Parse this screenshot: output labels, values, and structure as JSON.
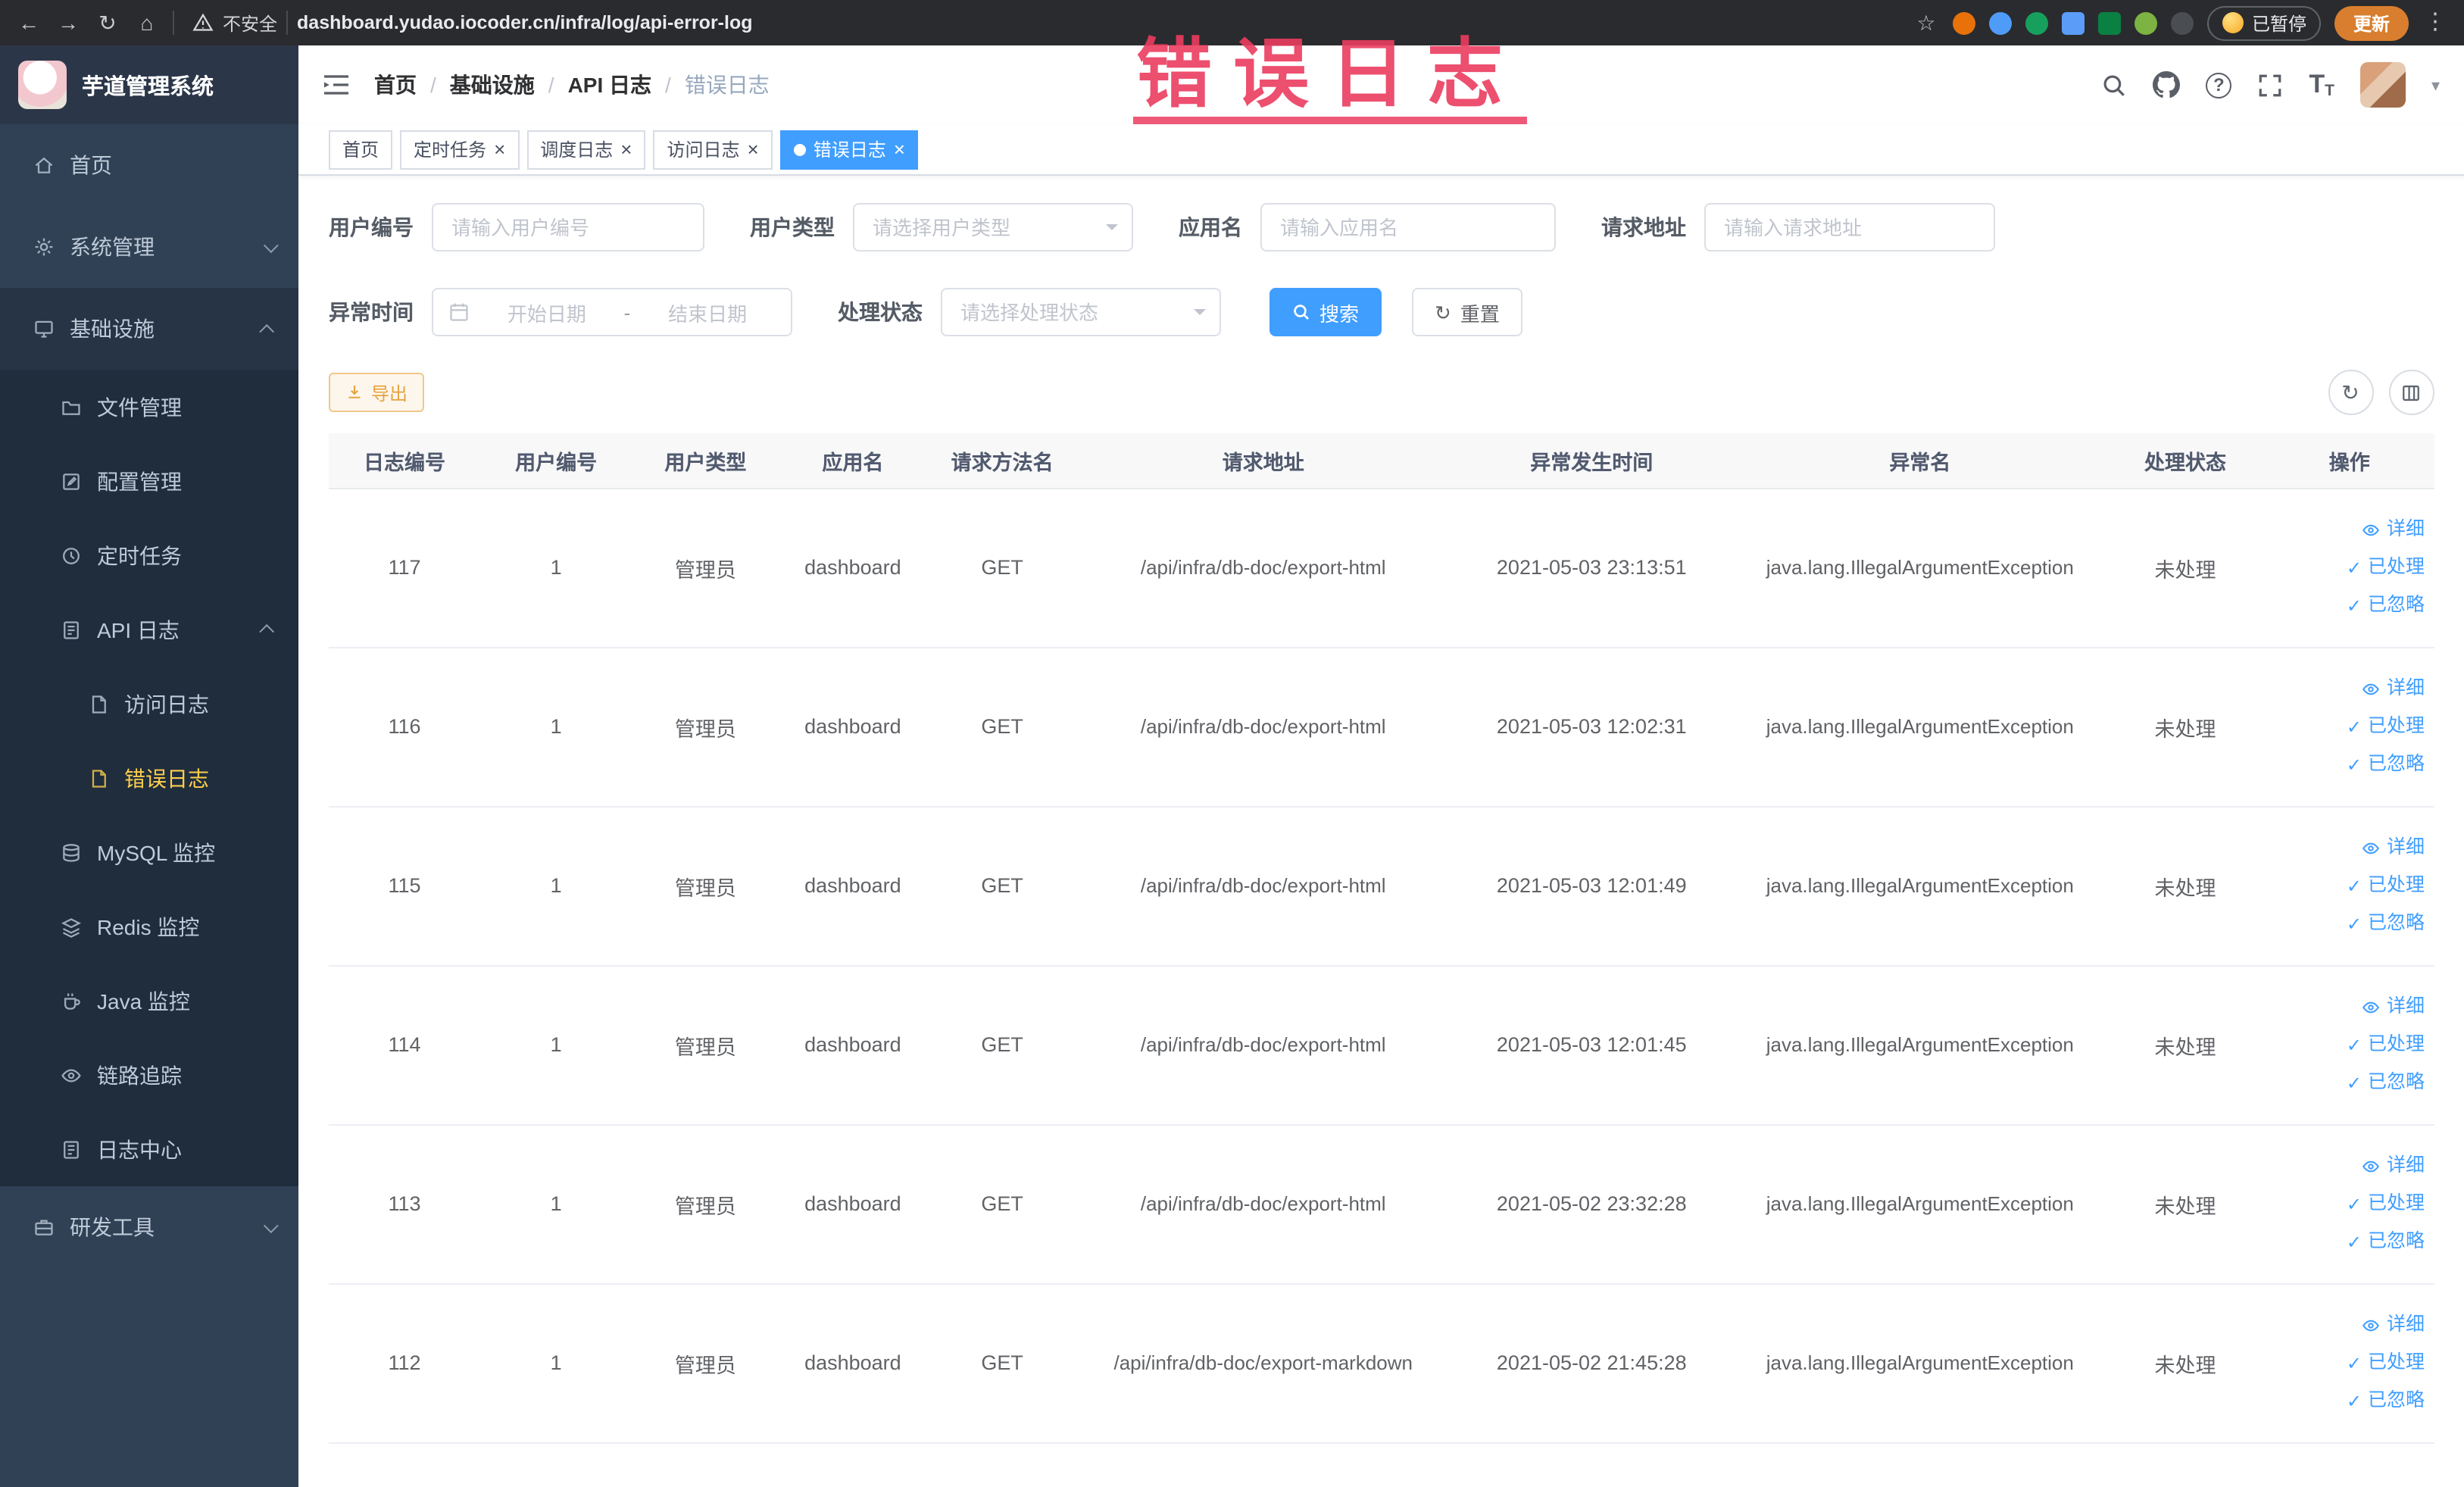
{
  "chrome": {
    "security_label": "不安全",
    "url": "dashboard.yudao.iocoder.cn/infra/log/api-error-log",
    "paused_badge": "已暂停",
    "update_button": "更新"
  },
  "icons": {
    "back": "←",
    "forward": "→",
    "reload": "↻",
    "home": "⌂",
    "star": "☆",
    "kebab": "⋮",
    "close": "×",
    "check": "✓",
    "caret": "▾",
    "question": "?",
    "text_size": "T"
  },
  "annotation": {
    "text": "错误日志"
  },
  "sidebar": {
    "logo_title": "芋道管理系统",
    "items": {
      "home": "首页",
      "system": "系统管理",
      "infra": "基础设施",
      "file": "文件管理",
      "config": "配置管理",
      "job": "定时任务",
      "apilog": "API 日志",
      "accesslog": "访问日志",
      "errorlog": "错误日志",
      "mysql": "MySQL 监控",
      "redis": "Redis 监控",
      "java": "Java 监控",
      "trace": "链路追踪",
      "logcenter": "日志中心",
      "devtools": "研发工具"
    }
  },
  "header": {
    "breadcrumb": [
      "首页",
      "基础设施",
      "API 日志",
      "错误日志"
    ],
    "separator": "/"
  },
  "tabs": [
    "首页",
    "定时任务",
    "调度日志",
    "访问日志",
    "错误日志"
  ],
  "filters": {
    "user_id_label": "用户编号",
    "user_id_placeholder": "请输入用户编号",
    "user_type_label": "用户类型",
    "user_type_placeholder": "请选择用户类型",
    "app_label": "应用名",
    "app_placeholder": "请输入应用名",
    "url_label": "请求地址",
    "url_placeholder": "请输入请求地址",
    "time_label": "异常时间",
    "time_start_placeholder": "开始日期",
    "time_separator": "-",
    "time_end_placeholder": "结束日期",
    "status_label": "处理状态",
    "status_placeholder": "请选择处理状态",
    "search_button": "搜索",
    "reset_button": "重置"
  },
  "toolbar": {
    "export_button": "导出"
  },
  "table": {
    "columns": [
      "日志编号",
      "用户编号",
      "用户类型",
      "应用名",
      "请求方法名",
      "请求地址",
      "异常发生时间",
      "异常名",
      "处理状态",
      "操作"
    ],
    "action_labels": [
      "详细",
      "已处理",
      "已忽略"
    ],
    "rows": [
      {
        "id": "117",
        "userId": "1",
        "userType": "管理员",
        "app": "dashboard",
        "method": "GET",
        "url": "/api/infra/db-doc/export-html",
        "time": "2021-05-03 23:13:51",
        "exception": "java.lang.IllegalArgumentException",
        "status": "未处理"
      },
      {
        "id": "116",
        "userId": "1",
        "userType": "管理员",
        "app": "dashboard",
        "method": "GET",
        "url": "/api/infra/db-doc/export-html",
        "time": "2021-05-03 12:02:31",
        "exception": "java.lang.IllegalArgumentException",
        "status": "未处理"
      },
      {
        "id": "115",
        "userId": "1",
        "userType": "管理员",
        "app": "dashboard",
        "method": "GET",
        "url": "/api/infra/db-doc/export-html",
        "time": "2021-05-03 12:01:49",
        "exception": "java.lang.IllegalArgumentException",
        "status": "未处理"
      },
      {
        "id": "114",
        "userId": "1",
        "userType": "管理员",
        "app": "dashboard",
        "method": "GET",
        "url": "/api/infra/db-doc/export-html",
        "time": "2021-05-03 12:01:45",
        "exception": "java.lang.IllegalArgumentException",
        "status": "未处理"
      },
      {
        "id": "113",
        "userId": "1",
        "userType": "管理员",
        "app": "dashboard",
        "method": "GET",
        "url": "/api/infra/db-doc/export-html",
        "time": "2021-05-02 23:32:28",
        "exception": "java.lang.IllegalArgumentException",
        "status": "未处理"
      },
      {
        "id": "112",
        "userId": "1",
        "userType": "管理员",
        "app": "dashboard",
        "method": "GET",
        "url": "/api/infra/db-doc/export-markdown",
        "time": "2021-05-02 21:45:28",
        "exception": "java.lang.IllegalArgumentException",
        "status": "未处理"
      }
    ]
  }
}
